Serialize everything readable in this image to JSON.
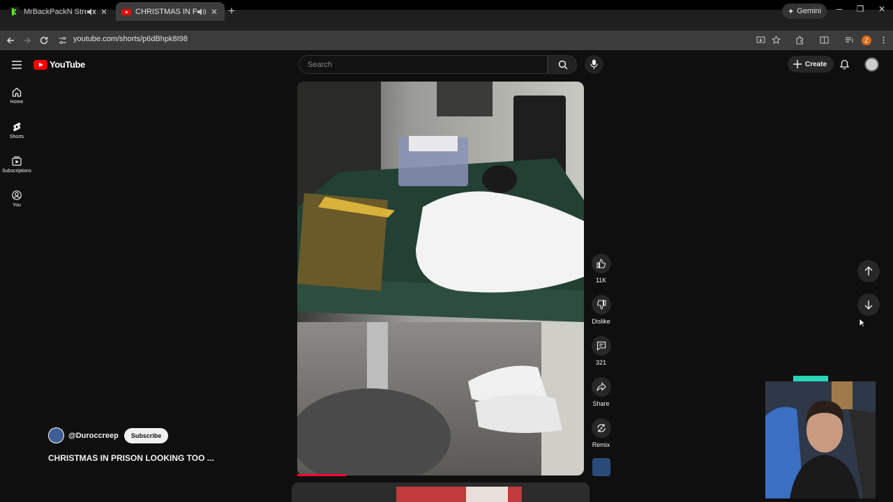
{
  "browser": {
    "tabs": [
      {
        "title": "MrBackPackN Stream - Wa",
        "active": false,
        "favicon_color": "#53fc18"
      },
      {
        "title": "CHRISTMAS IN PRISON LO",
        "active": true,
        "favicon_color": "#ff0000"
      }
    ],
    "gemini_label": "Gemini",
    "url": "youtube.com/shorts/p6dBhpk8I98",
    "profile_initial": "Z"
  },
  "youtube": {
    "logo_text": "YouTube",
    "search_placeholder": "Search",
    "create_label": "Create",
    "sidebar": [
      {
        "label": "Home",
        "icon": "home-icon"
      },
      {
        "label": "Shorts",
        "icon": "shorts-icon"
      },
      {
        "label": "Subscriptions",
        "icon": "subscriptions-icon"
      },
      {
        "label": "You",
        "icon": "you-icon"
      }
    ],
    "short": {
      "channel": "@Duroccreep",
      "subscribe_label": "Subscribe",
      "title": "CHRISTMAS IN PRISON LOOKING TOO ...",
      "progress_fraction": 0.17
    },
    "actions": {
      "likes": "11K",
      "dislike_label": "Dislike",
      "comments": "321",
      "share_label": "Share",
      "remix_label": "Remix"
    }
  },
  "colors": {
    "background": "#0f0f0f",
    "accent": "#ff0000",
    "progress": "#ff0033"
  }
}
